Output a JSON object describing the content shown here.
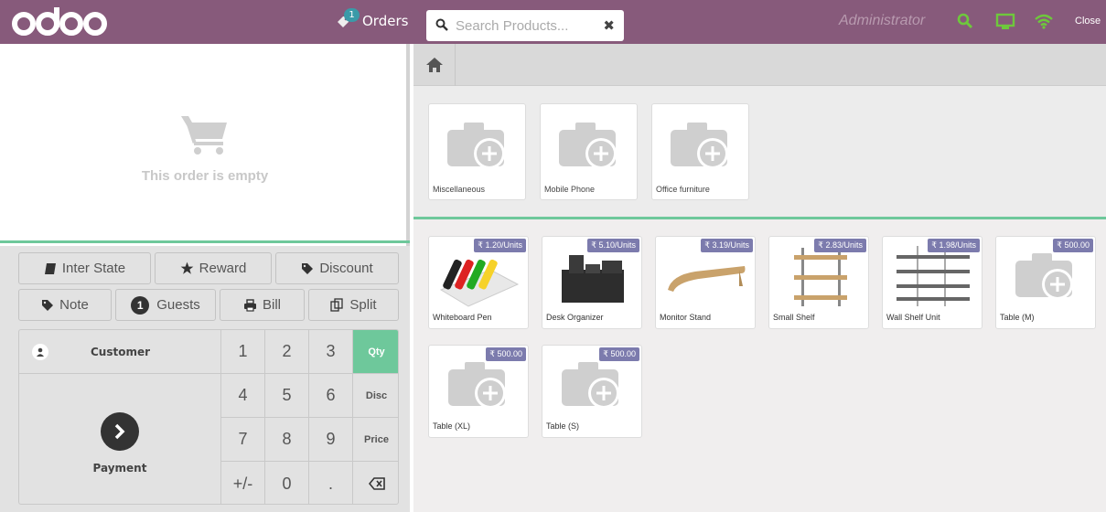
{
  "header": {
    "orders_label": "Orders",
    "orders_badge": "1",
    "search_placeholder": "Search Products...",
    "user": "Administrator",
    "close_label": "Close",
    "icons": [
      "search-icon",
      "monitor-icon",
      "wifi-icon"
    ]
  },
  "order": {
    "empty_text": "This order is empty"
  },
  "controls": {
    "inter_state": "Inter State",
    "reward": "Reward",
    "discount": "Discount",
    "note": "Note",
    "guests_count": "1",
    "guests": "Guests",
    "bill": "Bill",
    "split": "Split"
  },
  "numpad": {
    "customer": "Customer",
    "payment": "Payment",
    "keys": [
      "1",
      "2",
      "3",
      "4",
      "5",
      "6",
      "7",
      "8",
      "9",
      "+/-",
      "0",
      "."
    ],
    "modes": [
      "Qty",
      "Disc",
      "Price"
    ],
    "backspace_icon": "backspace-icon"
  },
  "categories": [
    {
      "name": "Miscellaneous"
    },
    {
      "name": "Mobile Phone"
    },
    {
      "name": "Office furniture"
    }
  ],
  "products": [
    {
      "name": "Whiteboard Pen",
      "price": "₹ 1.20/Units"
    },
    {
      "name": "Desk Organizer",
      "price": "₹ 5.10/Units"
    },
    {
      "name": "Monitor Stand",
      "price": "₹ 3.19/Units"
    },
    {
      "name": "Small Shelf",
      "price": "₹ 2.83/Units"
    },
    {
      "name": "Wall Shelf Unit",
      "price": "₹ 1.98/Units"
    },
    {
      "name": "Table (M)",
      "price": "₹ 500.00"
    },
    {
      "name": "Table (XL)",
      "price": "₹ 500.00"
    },
    {
      "name": "Table (S)",
      "price": "₹ 500.00"
    }
  ],
  "colors": {
    "header_bg": "#875a7b",
    "accent_green": "#6ec89b",
    "price_tag": "#7c7bad",
    "connected_green": "#6ec83c"
  }
}
